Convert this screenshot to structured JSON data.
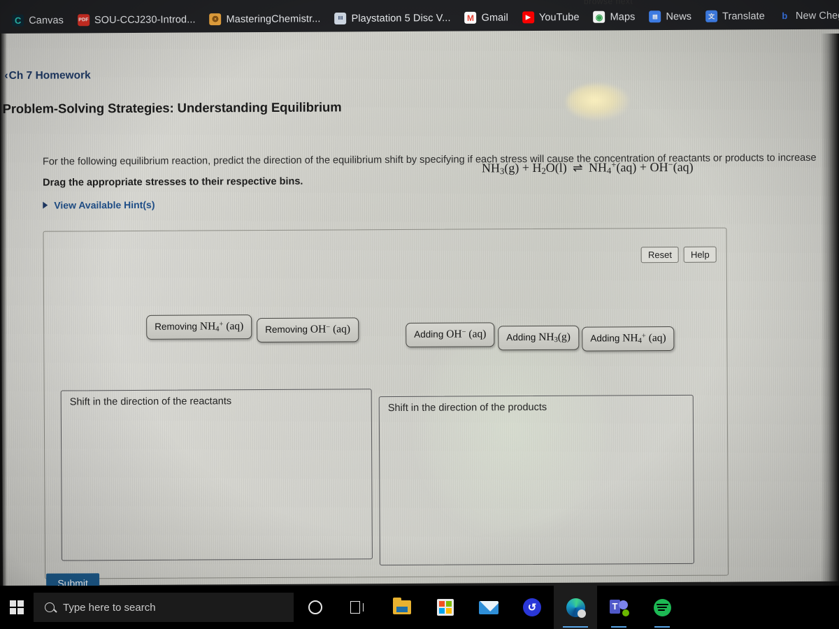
{
  "browser": {
    "ghost_tab_text": "browse  next",
    "bookmarks": [
      {
        "label": "Canvas",
        "icon": "canvas-icon",
        "glyph": "C"
      },
      {
        "label": "SOU-CCJ230-Introd...",
        "icon": "pdf-icon",
        "glyph": "PDF"
      },
      {
        "label": "MasteringChemistr...",
        "icon": "mastering-chemistry-icon",
        "glyph": "❂"
      },
      {
        "label": "Playstation 5 Disc V...",
        "icon": "playstation-icon",
        "glyph": "‖‖"
      },
      {
        "label": "Gmail",
        "icon": "gmail-icon",
        "glyph": "M"
      },
      {
        "label": "YouTube",
        "icon": "youtube-icon",
        "glyph": "▶"
      },
      {
        "label": "Maps",
        "icon": "google-maps-icon",
        "glyph": "◉"
      },
      {
        "label": "News",
        "icon": "google-news-icon",
        "glyph": "▤"
      },
      {
        "label": "Translate",
        "icon": "google-translate-icon",
        "glyph": "文"
      },
      {
        "label": "New Chegg",
        "icon": "chegg-icon",
        "glyph": "b"
      }
    ]
  },
  "header": {
    "breadcrumb_chevron": "‹",
    "breadcrumb": "Ch 7 Homework",
    "title": "Problem-Solving Strategies: Understanding Equilibrium"
  },
  "question": {
    "prompt": "For the following equilibrium reaction, predict the direction of the equilibrium shift by specifying if each stress will cause the concentration of reactants or products to increase",
    "equation": {
      "reactant_1": "NH",
      "reactant_1_sub": "3",
      "reactant_1_state": "(g)",
      "plus_1": "+",
      "reactant_2": "H",
      "reactant_2_sub": "2",
      "reactant_2_rest": "O(l)",
      "arrow": "⇌",
      "product_1": "NH",
      "product_1_sub": "4",
      "product_1_sup": "+",
      "product_1_state": "(aq)",
      "plus_2": "+",
      "product_2": "OH",
      "product_2_sup": "−",
      "product_2_state": "(aq)"
    },
    "instruction": "Drag the appropriate stresses to their respective bins.",
    "hint_label": "View Available Hint(s)"
  },
  "panel": {
    "reset_label": "Reset",
    "help_label": "Help"
  },
  "tiles": [
    {
      "verb": "Removing",
      "formula": "NH",
      "sub": "4",
      "sup": "+",
      "state": "(aq)"
    },
    {
      "verb": "Removing",
      "formula": "OH",
      "sub": "",
      "sup": "−",
      "state": "(aq)"
    },
    {
      "verb": "Adding",
      "formula": "OH",
      "sub": "",
      "sup": "−",
      "state": "(aq)"
    },
    {
      "verb": "Adding",
      "formula": "NH",
      "sub": "3",
      "sup": "",
      "state": "(g)"
    },
    {
      "verb": "Adding",
      "formula": "NH",
      "sub": "4",
      "sup": "+",
      "state": "(aq)"
    }
  ],
  "bins": [
    {
      "label": "Shift in the direction of the reactants",
      "items": []
    },
    {
      "label": "Shift in the direction of the products",
      "items": []
    }
  ],
  "submit": {
    "label": "Submit"
  },
  "taskbar": {
    "search_placeholder": "Type here to search",
    "icons": [
      {
        "name": "cortana-icon"
      },
      {
        "name": "task-view-icon"
      },
      {
        "name": "file-explorer-icon"
      },
      {
        "name": "microsoft-store-icon"
      },
      {
        "name": "mail-icon"
      },
      {
        "name": "cortana-app-icon"
      },
      {
        "name": "microsoft-edge-icon"
      },
      {
        "name": "microsoft-teams-icon"
      },
      {
        "name": "spotify-icon"
      }
    ]
  },
  "colors": {
    "accent_blue": "#1d5c8e",
    "link_blue": "#1f4e87",
    "page_bg": "#cdcdc6",
    "taskbar_bg": "#000000",
    "bookmark_bar_bg": "#202124"
  }
}
